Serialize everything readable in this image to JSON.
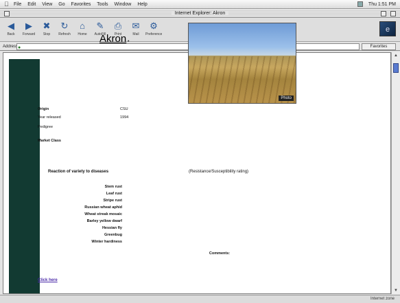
{
  "menubar": {
    "items": [
      "File",
      "Edit",
      "View",
      "Go",
      "Favorites",
      "Tools",
      "Window",
      "Help"
    ],
    "right_items": [
      "Thu 1:51 PM"
    ]
  },
  "window": {
    "title": "Internet Explorer: Akron"
  },
  "toolbar": {
    "buttons": [
      {
        "label": "Back",
        "icon": "back-arrow-icon"
      },
      {
        "label": "Forward",
        "icon": "forward-arrow-icon"
      },
      {
        "label": "Stop",
        "icon": "stop-icon"
      },
      {
        "label": "Refresh",
        "icon": "refresh-icon"
      },
      {
        "label": "Home",
        "icon": "home-icon"
      },
      {
        "label": "AutoFill",
        "icon": "autofill-icon"
      },
      {
        "label": "Print",
        "icon": "print-icon"
      },
      {
        "label": "Mail",
        "icon": "mail-icon"
      },
      {
        "label": "Preferences",
        "icon": "preferences-icon"
      }
    ]
  },
  "address": {
    "label": "Address",
    "value": "",
    "favorites_label": "Favorites"
  },
  "page": {
    "title": "Akron",
    "info": [
      {
        "label": "Origin",
        "value": "CSU"
      },
      {
        "label": "Year released",
        "value": "1994"
      },
      {
        "label": "Pedigree",
        "value": ""
      },
      {
        "label": "Market Class",
        "value": ""
      }
    ],
    "photo_credit": "Photo",
    "variety_head": "Reaction of variety to diseases",
    "variety_head_right": "(Resistance/Susceptibility rating)",
    "rows": [
      {
        "label": "Stem rust",
        "num": "",
        "ref": ""
      },
      {
        "label": "Leaf rust",
        "num": "",
        "ref": ""
      },
      {
        "label": "Stripe rust",
        "num": "",
        "ref": ""
      },
      {
        "label": "Russian wheat aphid",
        "num": "",
        "ref": ""
      },
      {
        "label": "Wheat streak mosaic",
        "num": "",
        "ref": ""
      },
      {
        "label": "Barley yellow dwarf",
        "num": "",
        "ref": ""
      },
      {
        "label": "Hessian fly",
        "num": "",
        "ref": ""
      },
      {
        "label": "Greenbug",
        "num": "",
        "ref": ""
      },
      {
        "label": "Winter hardiness",
        "num": "",
        "ref": ""
      }
    ],
    "note": "Comments:",
    "link_text": "Click here",
    "link_rest": ""
  },
  "status": {
    "left": "",
    "right": "Internet zone"
  }
}
